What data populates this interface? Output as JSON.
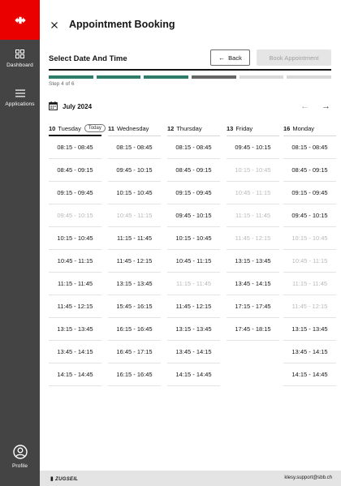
{
  "sidebar": {
    "brand_icon": "sbb-logo-icon",
    "items": [
      {
        "label": "Dashboard",
        "icon": "grid-icon"
      },
      {
        "label": "Applications",
        "icon": "hamburger-icon"
      }
    ],
    "profile": {
      "label": "Profile",
      "icon": "user-circle-icon"
    }
  },
  "header": {
    "title": "Appointment Booking",
    "close_icon": "close-icon"
  },
  "section": {
    "title": "Select Date And Time",
    "back_label": "Back",
    "book_label": "Book Appointment"
  },
  "progress": {
    "step_label": "Step 4 of 6",
    "current_step": 4,
    "total_steps": 6,
    "colors": {
      "done": "#2e7d6b",
      "current": "#666666",
      "todo": "#d8d8d8"
    }
  },
  "calendar": {
    "month": "July 2024"
  },
  "days": [
    {
      "num": "10",
      "name": "Tuesday",
      "badge": "Today",
      "slots": [
        {
          "t": "08:15 - 08:45",
          "a": true
        },
        {
          "t": "08:45 - 09:15",
          "a": true
        },
        {
          "t": "09:15 - 09:45",
          "a": true
        },
        {
          "t": "09:45 - 10:15",
          "a": false
        },
        {
          "t": "10:15 - 10:45",
          "a": true
        },
        {
          "t": "10:45 - 11:15",
          "a": true
        },
        {
          "t": "11:15 - 11:45",
          "a": true
        },
        {
          "t": "11:45 - 12:15",
          "a": true
        },
        {
          "t": "13:15 - 13:45",
          "a": true
        },
        {
          "t": "13:45 - 14:15",
          "a": true
        },
        {
          "t": "14:15 - 14:45",
          "a": true
        }
      ]
    },
    {
      "num": "11",
      "name": "Wednesday",
      "badge": "",
      "slots": [
        {
          "t": "08:15 - 08:45",
          "a": true
        },
        {
          "t": "09:45 - 10:15",
          "a": true
        },
        {
          "t": "10:15 - 10:45",
          "a": true
        },
        {
          "t": "10:45 - 11:15",
          "a": false
        },
        {
          "t": "11:15 - 11:45",
          "a": true
        },
        {
          "t": "11:45 - 12:15",
          "a": true
        },
        {
          "t": "13:15 - 13:45",
          "a": true
        },
        {
          "t": "15:45 - 16:15",
          "a": true
        },
        {
          "t": "16:15 - 16:45",
          "a": true
        },
        {
          "t": "16:45 - 17:15",
          "a": true
        },
        {
          "t": "16:15 - 16:45",
          "a": true
        }
      ]
    },
    {
      "num": "12",
      "name": "Thursday",
      "badge": "",
      "slots": [
        {
          "t": "08:15 - 08:45",
          "a": true
        },
        {
          "t": "08:45 - 09:15",
          "a": true
        },
        {
          "t": "09:15 - 09:45",
          "a": true
        },
        {
          "t": "09:45 - 10:15",
          "a": true
        },
        {
          "t": "10:15 - 10:45",
          "a": true
        },
        {
          "t": "10:45 - 11:15",
          "a": true
        },
        {
          "t": "11:15 - 11:45",
          "a": false
        },
        {
          "t": "11:45 - 12:15",
          "a": true
        },
        {
          "t": "13:15 - 13:45",
          "a": true
        },
        {
          "t": "13:45 - 14:15",
          "a": true
        },
        {
          "t": "14:15 - 14:45",
          "a": true
        }
      ]
    },
    {
      "num": "13",
      "name": "Friday",
      "badge": "",
      "slots": [
        {
          "t": "09:45 - 10:15",
          "a": true
        },
        {
          "t": "10:15 - 10:45",
          "a": false
        },
        {
          "t": "10:45 - 11:15",
          "a": false
        },
        {
          "t": "11:15 - 11:45",
          "a": false
        },
        {
          "t": "11:45 - 12:15",
          "a": false
        },
        {
          "t": "13:15 - 13:45",
          "a": true
        },
        {
          "t": "13:45 - 14:15",
          "a": true
        },
        {
          "t": "17:15 - 17:45",
          "a": true
        },
        {
          "t": "17:45 - 18:15",
          "a": true
        }
      ]
    },
    {
      "num": "16",
      "name": "Monday",
      "badge": "",
      "slots": [
        {
          "t": "08:15 - 08:45",
          "a": true
        },
        {
          "t": "08:45 - 09:15",
          "a": true
        },
        {
          "t": "09:15 - 09:45",
          "a": true
        },
        {
          "t": "09:45 - 10:15",
          "a": true
        },
        {
          "t": "10:15 - 10:45",
          "a": false
        },
        {
          "t": "10:45 - 11:15",
          "a": false
        },
        {
          "t": "11:15 - 11:45",
          "a": false
        },
        {
          "t": "11:45 - 12:15",
          "a": false
        },
        {
          "t": "13:15 - 13:45",
          "a": true
        },
        {
          "t": "13:45 - 14:15",
          "a": true
        },
        {
          "t": "14:15 - 14:45",
          "a": true
        }
      ]
    }
  ],
  "footer": {
    "logo": "ZUGSEIL",
    "email": "klesy.support@sbb.ch"
  }
}
